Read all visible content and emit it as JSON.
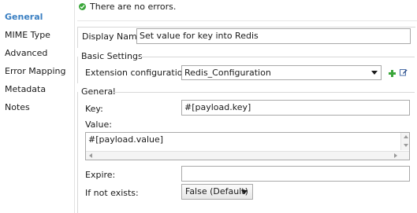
{
  "sidebar": {
    "items": [
      {
        "label": "General",
        "active": true
      },
      {
        "label": "MIME Type"
      },
      {
        "label": "Advanced"
      },
      {
        "label": "Error Mapping"
      },
      {
        "label": "Metadata"
      },
      {
        "label": "Notes"
      }
    ]
  },
  "status": {
    "text": "There are no errors.",
    "icon": "check-circle-icon",
    "color": "#3aa63a"
  },
  "display_name": {
    "label": "Display Name:",
    "value": "Set value for key into Redis"
  },
  "basic_settings": {
    "title": "Basic Settings",
    "extension_label": "Extension configuration:",
    "extension_value": "Redis_Configuration",
    "add_icon": "add-icon",
    "edit_icon": "edit-icon"
  },
  "general": {
    "title": "General",
    "key_label": "Key:",
    "key_value": "#[payload.key]",
    "value_label": "Value:",
    "value_value": "#[payload.value]",
    "expire_label": "Expire:",
    "expire_value": "",
    "if_not_exists_label": "If not exists:",
    "if_not_exists_value": "False (Default)"
  },
  "colors": {
    "accent": "#3a7fc2",
    "add_green": "#3aa63a"
  }
}
